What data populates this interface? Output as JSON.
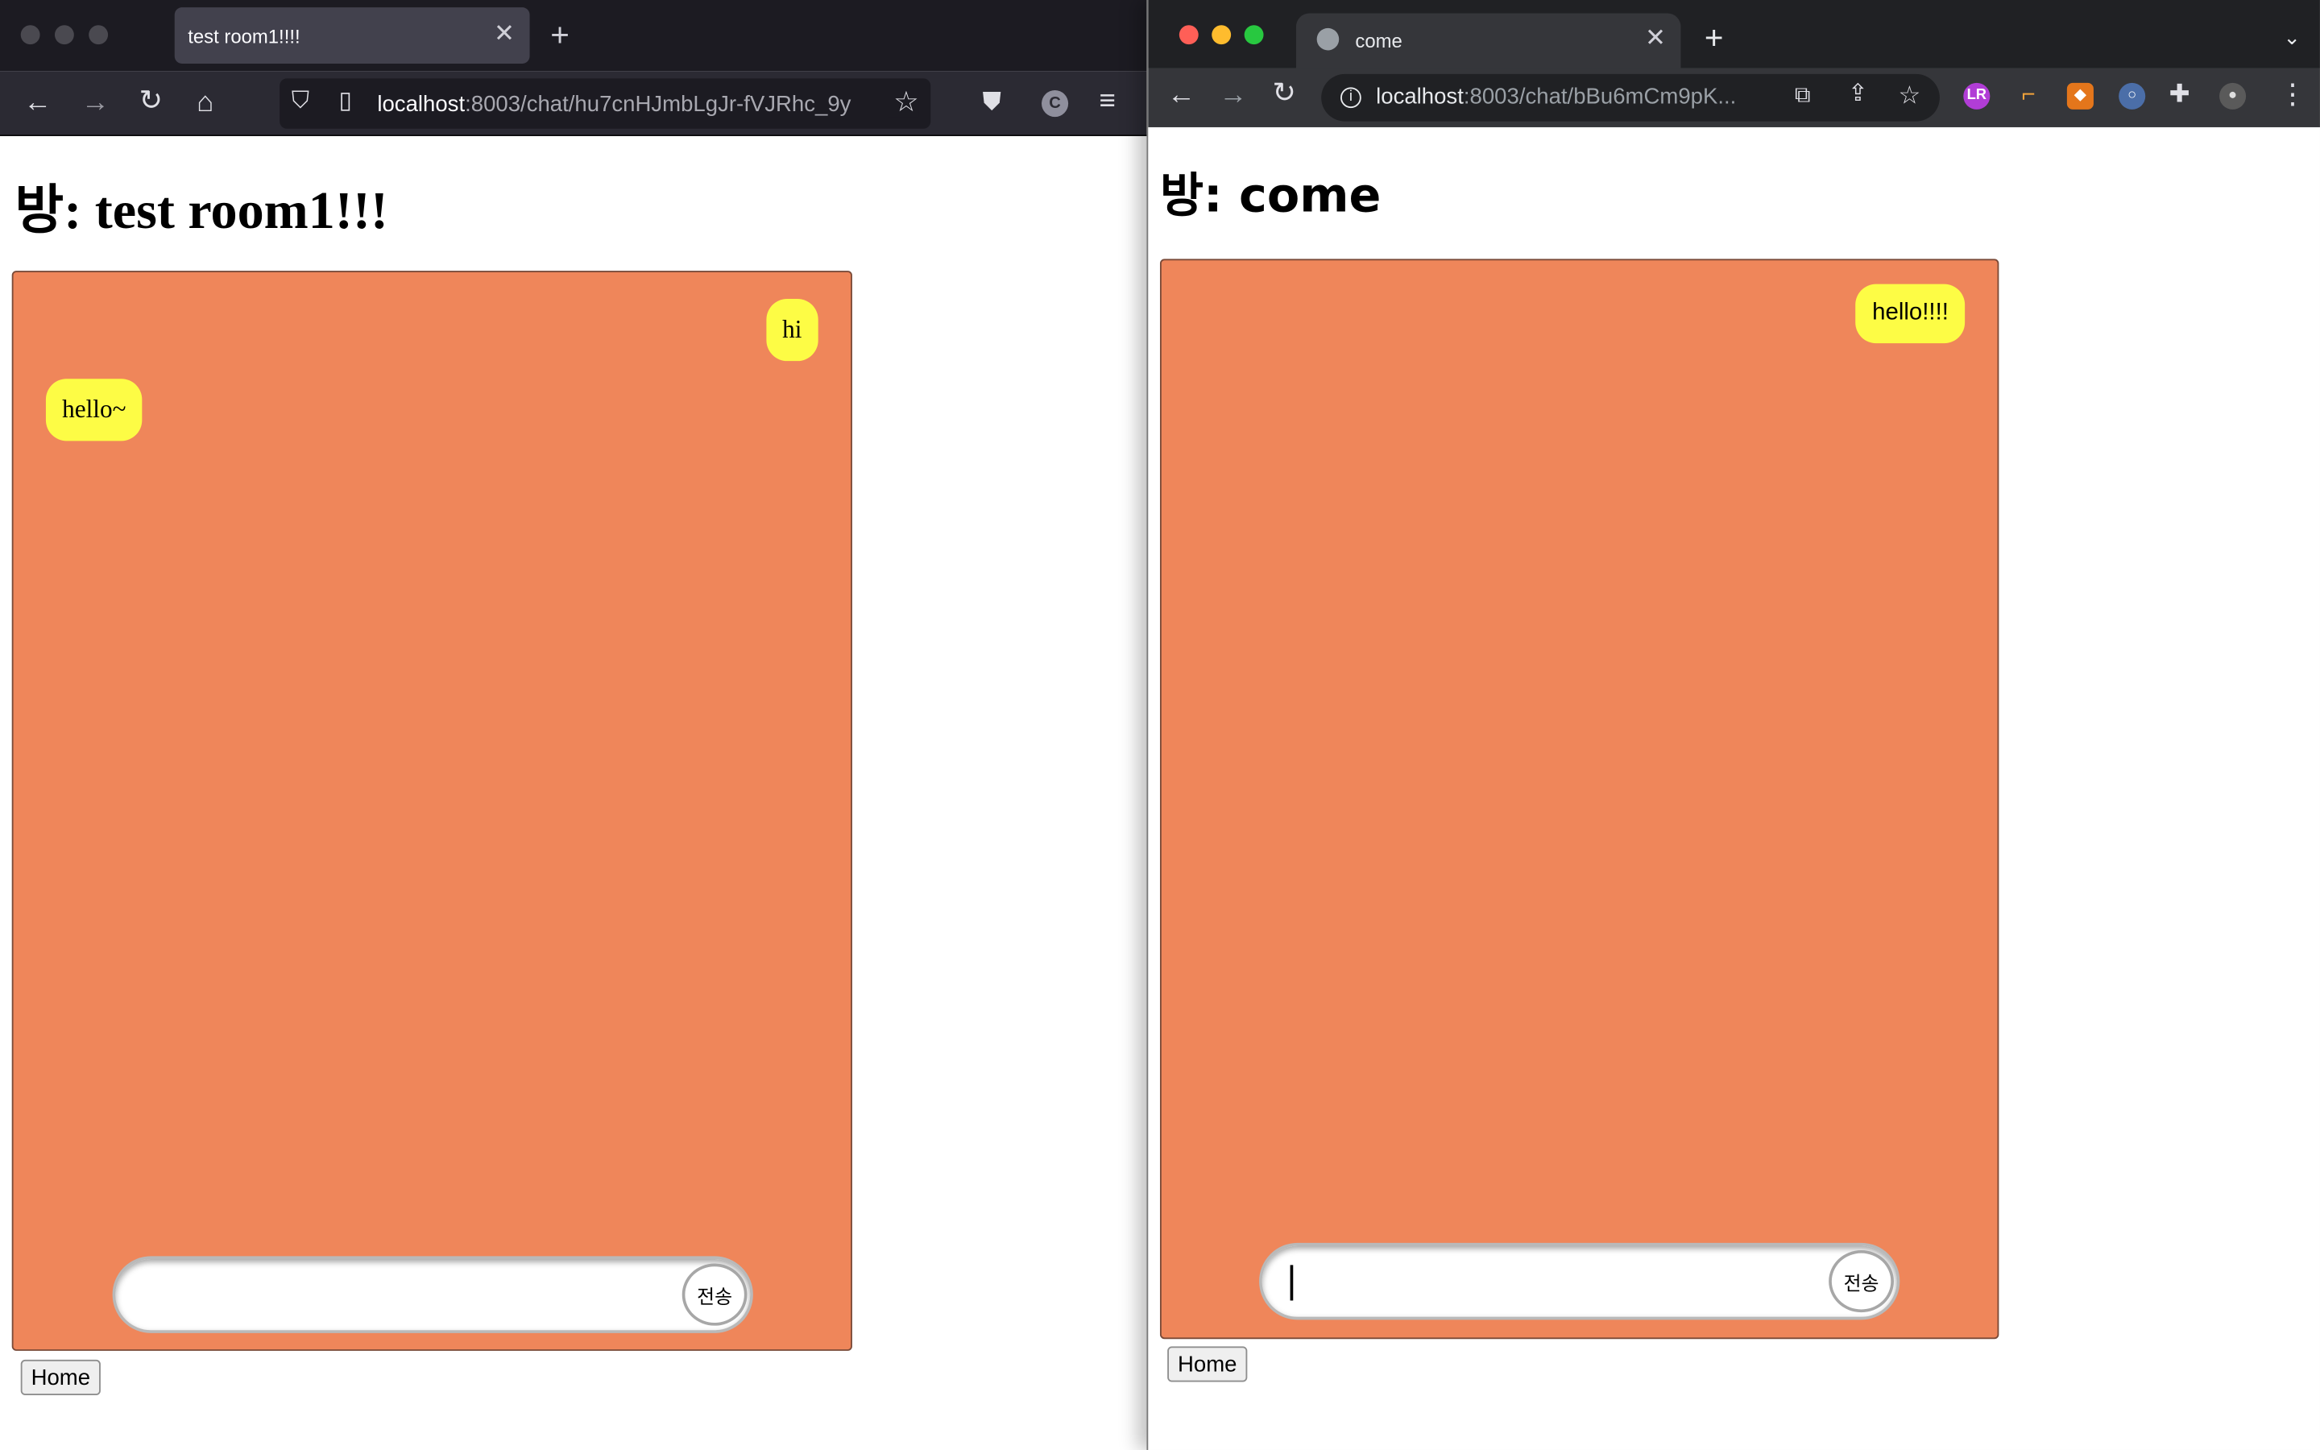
{
  "left_browser": {
    "tab_title": "test room1!!!!",
    "url_host": "localhost",
    "url_rest": ":8003/chat/hu7cnHJmbLgJr-fVJRhc_9y",
    "page_title": "방: test room1!!!",
    "messages": [
      {
        "text": "hi",
        "side": "right"
      },
      {
        "text": "hello~",
        "side": "left"
      }
    ],
    "input_value": "",
    "send_label": "전송",
    "home_label": "Home",
    "extension_letter": "C"
  },
  "right_browser": {
    "tab_title": "come",
    "url_host": "localhost",
    "url_rest": ":8003/chat/bBu6mCm9pK...",
    "page_title": "방: come",
    "messages": [
      {
        "text": "hello!!!!",
        "side": "right"
      }
    ],
    "input_value": "",
    "send_label": "전송",
    "home_label": "Home",
    "extension_letter": "LR"
  },
  "colors": {
    "chat_background": "#ef865a",
    "bubble": "#fdfc45",
    "firefox_chrome": "#2b2a33",
    "chrome_chrome": "#35363a",
    "mac_close": "#ff5f57",
    "mac_minimize": "#febc2e",
    "mac_zoom": "#28c840"
  }
}
